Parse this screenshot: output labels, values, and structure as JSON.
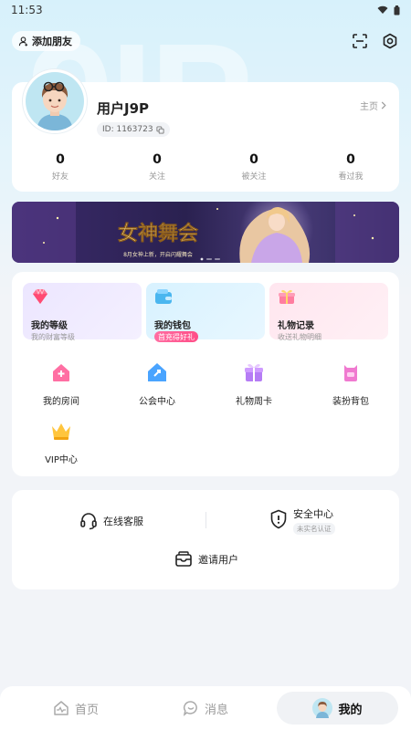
{
  "status_bar": {
    "time": "11:53"
  },
  "header": {
    "add_friend_label": "添加朋友"
  },
  "profile": {
    "username": "用户J9P",
    "user_id": "ID: 1163723",
    "homepage_link": "主页",
    "stats": [
      {
        "value": "0",
        "label": "好友"
      },
      {
        "value": "0",
        "label": "关注"
      },
      {
        "value": "0",
        "label": "被关注"
      },
      {
        "value": "0",
        "label": "看过我"
      }
    ]
  },
  "banner": {
    "title": "女神舞会",
    "subtitle": "8月女神上新，开启闪耀舞会"
  },
  "features": [
    {
      "title": "我的等级",
      "subtitle": "我的财富等级"
    },
    {
      "title": "我的钱包",
      "badge": "首充得好礼"
    },
    {
      "title": "礼物记录",
      "subtitle": "收送礼物明细"
    }
  ],
  "grid": [
    {
      "label": "我的房间",
      "icon": "home-icon"
    },
    {
      "label": "公会中心",
      "icon": "guild-icon"
    },
    {
      "label": "礼物周卡",
      "icon": "gift-card-icon"
    },
    {
      "label": "装扮背包",
      "icon": "backpack-icon"
    },
    {
      "label": "VIP中心",
      "icon": "crown-icon"
    }
  ],
  "services": {
    "online_service": "在线客服",
    "security_center": "安全中心",
    "security_status": "未实名认证",
    "invite_users": "邀请用户"
  },
  "tabs": [
    {
      "label": "首页",
      "icon": "pulse-icon"
    },
    {
      "label": "消息",
      "icon": "chat-icon"
    },
    {
      "label": "我的",
      "icon": "avatar-icon"
    }
  ],
  "colors": {
    "accent_pink": "#ff4d87",
    "background": "#f2f4f8",
    "top_gradient": "#d7f1fb"
  }
}
